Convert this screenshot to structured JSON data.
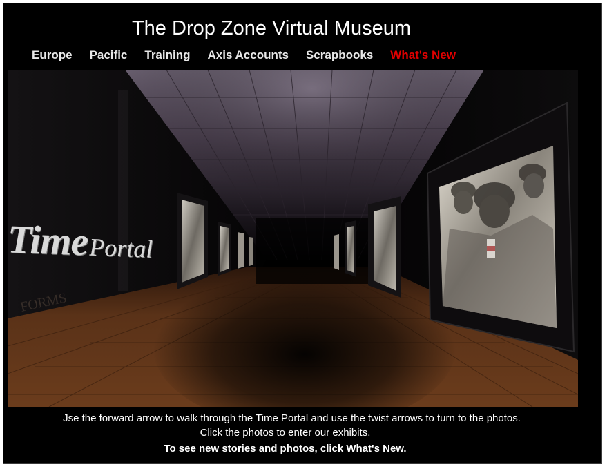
{
  "header": {
    "title": "The Drop Zone Virtual Museum"
  },
  "nav": {
    "items": [
      {
        "label": "Europe"
      },
      {
        "label": "Pacific"
      },
      {
        "label": "Training"
      },
      {
        "label": "Axis Accounts"
      },
      {
        "label": "Scrapbooks"
      },
      {
        "label": "What's New",
        "color": "#e10000"
      }
    ]
  },
  "scene": {
    "logo_big": "Time",
    "logo_small": "Portal"
  },
  "instructions": {
    "line1": "Jse the forward arrow to walk through the Time Portal and use the twist arrows to turn to the photos.",
    "line2": "Click the photos to enter our exhibits.",
    "line3": "To see new stories and photos, click What's New."
  }
}
